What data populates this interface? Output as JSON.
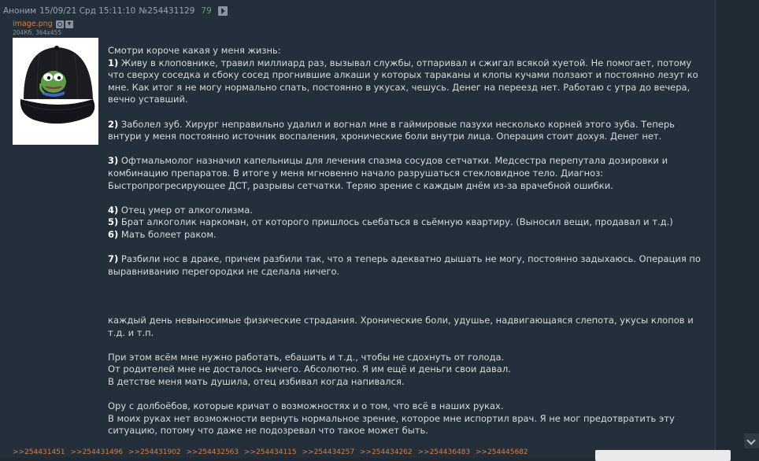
{
  "post": {
    "author": "Аноним",
    "date": "15/09/21 Срд 15:11:10",
    "number": "№254431129",
    "reply_count": "79",
    "file": {
      "name": "image.png",
      "meta": "204Кб, 364x455"
    },
    "body": {
      "intro": "Смотри короче какая у меня жизнь:",
      "items": [
        {
          "num": "1)",
          "text": " Живу в клоповнике, травил миллиард раз, вызывал службы, отпаривал и сжигал всякой хуетой. Не помогает, потому что сверху соседка и сбоку сосед прогнившие алкаши у которых тараканы и клопы кучами ползают и постоянно лезут ко мне. Как итог я не могу нормально спать, постоянно в укусах, чешусь. Денег на переезд нет. Работаю с утра до вечера, вечно уставший."
        },
        {
          "num": "2)",
          "text": " Заболел зуб. Хирург неправильно удалил и вогнал мне в гаймировые пазухи несколько корней этого зуба. Теперь внтури у меня постоянно источник воспаления, хронические боли внутри лица. Операция стоит дохуя. Денег нет."
        },
        {
          "num": "3)",
          "text": " Офтмальмолог назначил капельницы для лечения спазма сосудов сетчатки. Медсестра перепутала дозировки и комбинацию препаратов. В итоге у меня мгновенно начало разрушаться стекловидное тело. Диагноз: Быстропрогресирующее ДСТ, разрывы сетчатки. Теряю зрение с каждым днём из-за врачебной ошибки."
        },
        {
          "num": "4)",
          "text": " Отец умер от алкоголизма."
        },
        {
          "num": "5)",
          "text": " Брат алкоголик наркоман, от которого пришлось сьебаться в сьёмную квартиру. (Выносил вещи, продавал и т.д.)"
        },
        {
          "num": "6)",
          "text": " Мать болеет раком."
        },
        {
          "num": "7)",
          "text": " Разбили нос в драке, причем разбили так, что я теперь адекватно дышать не могу, постоянно задыхаюсь. Операция по выравниванию перегородки не сделала ничего."
        }
      ],
      "para_suffering": "каждый день невыносимые физические страдания. Хронические боли, удушье, надвигающаяся слепота, укусы клопов и т.д. и т.п.",
      "para_work_1": "При этом всём мне нужно работать, ебашить и т.д., чтобы не сдохнуть от голода.",
      "para_work_2": "От родителей мне не досталось ничего. Абсолютно. Я им ещё и деньги свои давал.",
      "para_work_3": "В детстве меня мать душила, отец избивал когда напивался.",
      "para_end_1": "Ору с долбоёбов, которые кричат о возможностях и о том, что всё в наших руках.",
      "para_end_2": "В моих руках нет возможности вернуть нормальное зрение, которое мне испортил врач. Я не мог предотвратить эту ситуацию, потому что даже не подозревал что такое может быть."
    },
    "reply_links": [
      ">>254431451",
      ">>254431496",
      ">>254431902",
      ">>254432563",
      ">>254434115",
      ">>254434257",
      ">>254434262",
      ">>254436483",
      ">>254445682"
    ]
  },
  "colors": {
    "background": "#1f2a35",
    "post_background": "#232f3a",
    "link_orange": "#e07a3a",
    "reply_count_green": "#6aa84f",
    "text": "#d6dadd"
  },
  "icons": [
    "play-icon",
    "search-icon",
    "download-icon",
    "chevron-down-icon"
  ],
  "thumbnail_description_icon": "pepe-cap-image"
}
